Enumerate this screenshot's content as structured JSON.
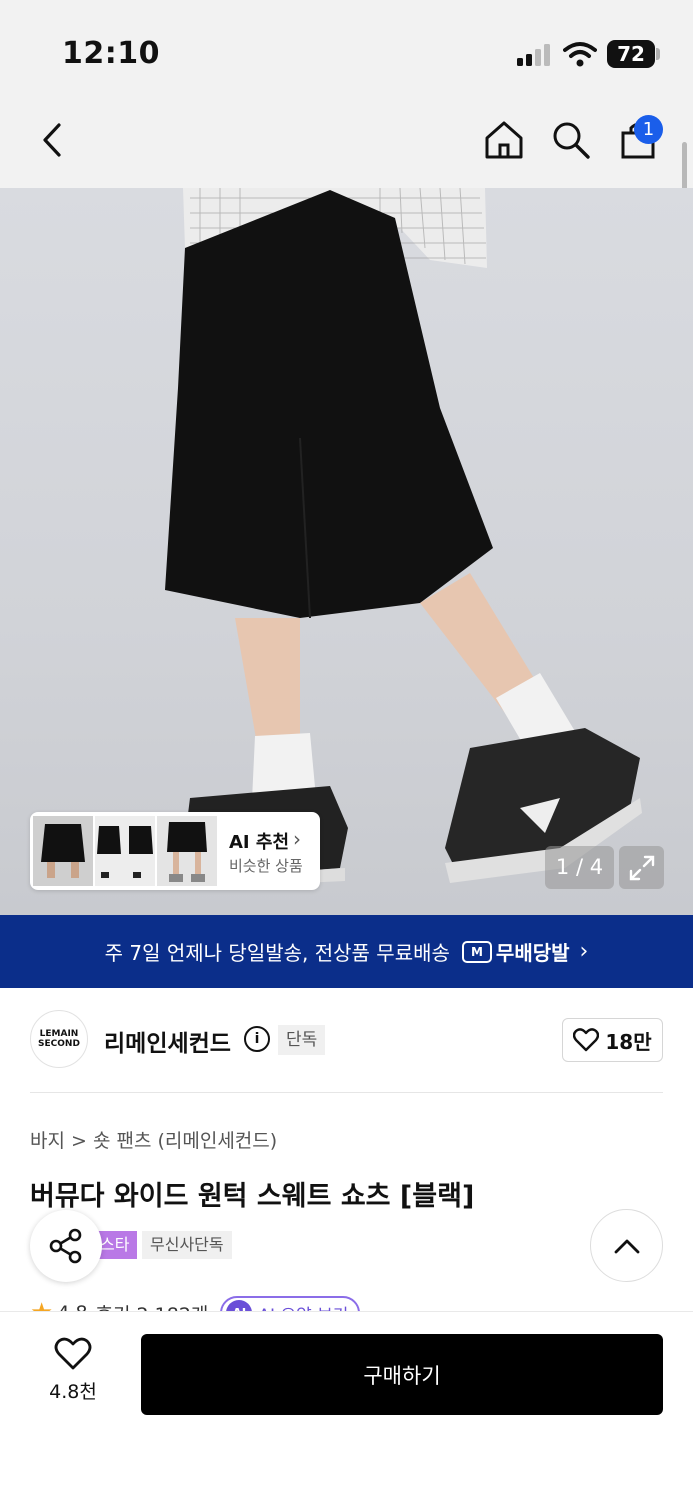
{
  "status_bar": {
    "time": "12:10",
    "battery": "72"
  },
  "nav": {
    "cart_badge": "1"
  },
  "hero": {
    "ai_recommend_title": "AI 추천",
    "ai_recommend_subtitle": "비슷한 상품",
    "pager": "1 / 4"
  },
  "banner": {
    "text": "주 7일 언제나 당일발송, 전상품 무료배송",
    "brand": "무배당발"
  },
  "brand": {
    "logo_text_line1": "LEMAIN",
    "logo_text_line2": "SECOND",
    "name": "리메인세컨드",
    "exclusive_tag": "단독",
    "likes": "18만"
  },
  "product": {
    "breadcrumb": "바지 > 숏 팬츠 (리메인세컨드)",
    "title": "버뮤다 와이드 원턱 스웨트 쇼츠 [블랙]",
    "tags": [
      "스타",
      "무신사단독"
    ],
    "rating": "4.8",
    "reviews": "후기 2,182개",
    "ai_summary_label": "AI 요약 보기"
  },
  "bottom": {
    "wish_count": "4.8천",
    "buy_label": "구매하기"
  },
  "colors": {
    "banner_bg": "#0b2e8a",
    "badge": "#1a5eea",
    "purple_tag": "#b978e6",
    "star": "#f5a623"
  }
}
